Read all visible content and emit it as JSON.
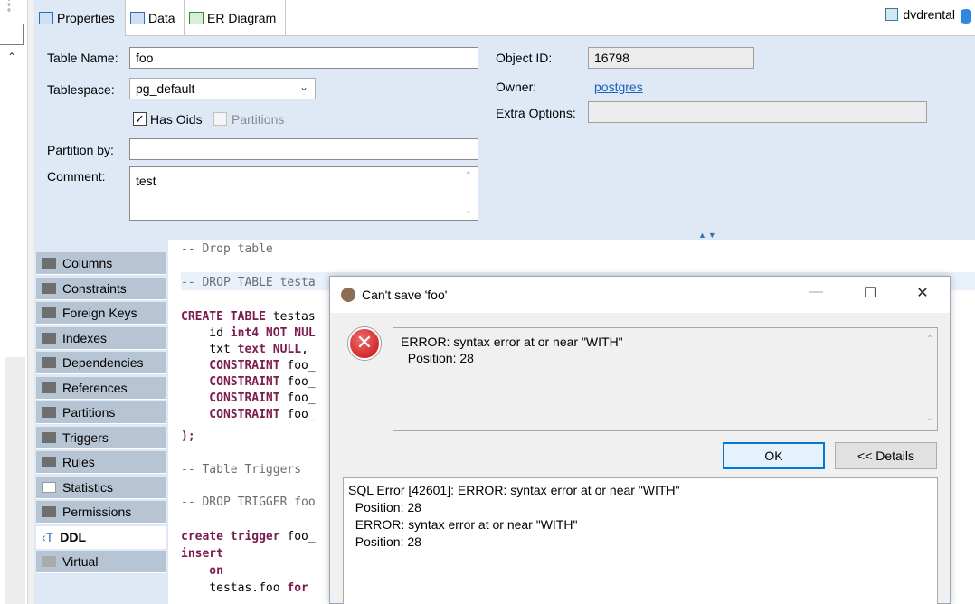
{
  "tabs": [
    {
      "label": "Properties",
      "icon": "properties-icon"
    },
    {
      "label": "Data",
      "icon": "data-grid-icon"
    },
    {
      "label": "ER Diagram",
      "icon": "er-diagram-icon"
    }
  ],
  "connection": {
    "name": "dvdrental",
    "icon": "database-icon"
  },
  "properties": {
    "table_name_label": "Table Name:",
    "table_name": "foo",
    "tablespace_label": "Tablespace:",
    "tablespace": "pg_default",
    "has_oids_label": "Has Oids",
    "has_oids_mark": "✓",
    "partitions_label": "Partitions",
    "partition_by_label": "Partition by:",
    "partition_by": "",
    "comment_label": "Comment:",
    "comment": "test",
    "object_id_label": "Object ID:",
    "object_id": "16798",
    "owner_label": "Owner:",
    "owner": "postgres",
    "extra_options_label": "Extra Options:",
    "extra_options": ""
  },
  "side_tabs": [
    "Columns",
    "Constraints",
    "Foreign Keys",
    "Indexes",
    "Dependencies",
    "References",
    "Partitions",
    "Triggers",
    "Rules",
    "Statistics",
    "Permissions",
    "DDL",
    "Virtual"
  ],
  "active_side_tab": "DDL",
  "ddl": {
    "l1": "-- Drop table",
    "l2": "-- DROP TABLE testa",
    "l3a": "CREATE TABLE",
    "l3b": " testas",
    "l4a": "    id ",
    "l4b": "int4 NOT NUL",
    "l5a": "    txt ",
    "l5b": "text NULL",
    "l5c": ",",
    "l6a": "    CONSTRAINT",
    "l6b": " foo_",
    "l7a": "    CONSTRAINT",
    "l7b": " foo_",
    "l8a": "    CONSTRAINT",
    "l8b": " foo_",
    "l9a": "    CONSTRAINT",
    "l9b": " foo_",
    "l10": ");",
    "l11": "-- Table Triggers",
    "l12": "-- DROP TRIGGER foo",
    "l13a": "create trigger",
    "l13b": " foo_",
    "l14": "insert",
    "l15": "    on",
    "l16a": "    testas.foo ",
    "l16b": "for"
  },
  "dialog": {
    "title": "Can't save 'foo'",
    "error_line1": "ERROR: syntax error at or near \"WITH\"",
    "error_line2": "  Position: 28",
    "ok_label": "OK",
    "details_label": "<< Details",
    "details_text": "SQL Error [42601]: ERROR: syntax error at or near \"WITH\"\n  Position: 28\n  ERROR: syntax error at or near \"WITH\"\n  Position: 28",
    "minimize": "—",
    "maximize": "☐",
    "close": "✕",
    "error_glyph": "✕"
  }
}
